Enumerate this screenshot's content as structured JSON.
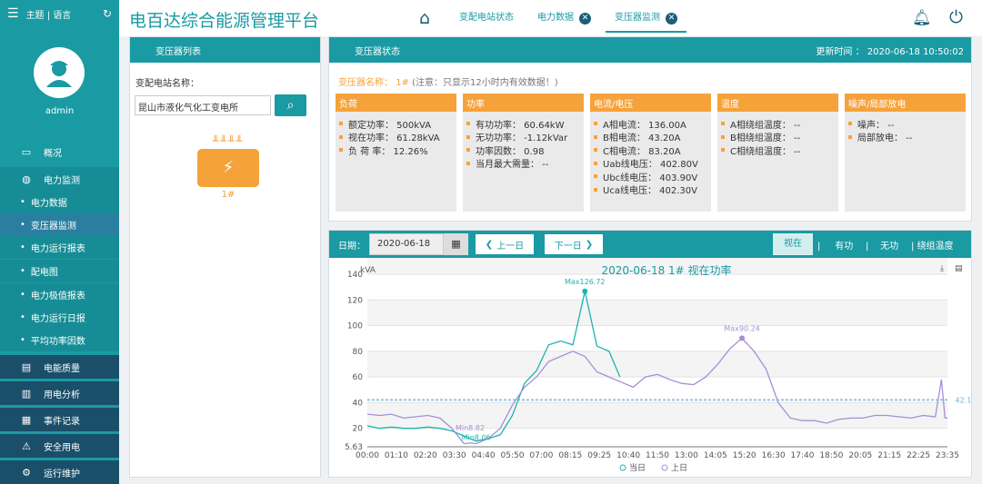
{
  "sidebar": {
    "top_label": "主题 | 语言",
    "user": "admin",
    "items": [
      {
        "icon": "monitor-icon",
        "label": "概况"
      },
      {
        "icon": "power-icon",
        "label": "电力监测"
      }
    ],
    "subitems": [
      "电力数据",
      "变压器监测",
      "电力运行报表",
      "配电图",
      "电力极值报表",
      "电力运行日报",
      "平均功率因数"
    ],
    "items2": [
      {
        "icon": "quality-icon",
        "label": "电能质量"
      },
      {
        "icon": "analysis-icon",
        "label": "用电分析"
      },
      {
        "icon": "event-icon",
        "label": "事件记录"
      },
      {
        "icon": "safety-icon",
        "label": "安全用电"
      },
      {
        "icon": "maintenance-icon",
        "label": "运行维护"
      }
    ]
  },
  "header": {
    "title": "电百达综合能源管理平台",
    "tabs": [
      "变配电站状态",
      "电力数据",
      "变压器监测"
    ]
  },
  "left": {
    "title": "变压器列表",
    "station_label": "变配电站名称：",
    "station_value": "昆山市液化气化工变电所",
    "transformer": "1#"
  },
  "status": {
    "title": "变压器状态",
    "update_time": "更新时间 ： 2020-06-18 10:50:02",
    "name_label": "变压器名称：",
    "name": "1#",
    "note": "(注意：只显示12小时内有效数据！)",
    "cards": [
      {
        "title": "负荷",
        "lines": [
          "额定功率： 500kVA",
          "视在功率： 61.28kVA",
          "负 荷 率： 12.26%"
        ]
      },
      {
        "title": "功率",
        "lines": [
          "有功功率： 60.64kW",
          "无功功率： -1.12kVar",
          "功率因数： 0.98",
          "当月最大需量： --"
        ]
      },
      {
        "title": "电流/电压",
        "lines": [
          "A相电流： 136.00A",
          "B相电流： 43.20A",
          "C相电流： 83.20A",
          "Uab线电压： 402.80V",
          "Ubc线电压： 403.90V",
          "Uca线电压： 402.30V"
        ]
      },
      {
        "title": "温度",
        "lines": [
          "A相绕组温度： --",
          "B相绕组温度： --",
          "C相绕组温度： --"
        ]
      },
      {
        "title": "噪声/局部放电",
        "lines": [
          "噪声： --",
          "局部放电： --"
        ]
      }
    ]
  },
  "chartpanel": {
    "date_label": "日期：",
    "date": "2020-06-18",
    "prev": "上一日",
    "next": "下一日",
    "types": [
      "视在",
      "有功",
      "无功",
      "绕组温度"
    ]
  },
  "chart_data": {
    "type": "line",
    "title": "2020-06-18  1#  视在功率",
    "ylabel": "kVA",
    "ylim": [
      5.63,
      140
    ],
    "yticks": [
      "140",
      "120",
      "100",
      "80",
      "60",
      "40",
      "20",
      "5.63"
    ],
    "xticks": [
      "00:00",
      "01:10",
      "02:20",
      "03:30",
      "04:40",
      "05:50",
      "07:00",
      "08:15",
      "09:25",
      "10:40",
      "11:50",
      "13:00",
      "14:05",
      "15:20",
      "16:30",
      "17:40",
      "18:50",
      "20:05",
      "21:15",
      "22:25",
      "23:35"
    ],
    "series": [
      {
        "name": "当日",
        "color": "#1ab5b0",
        "points": [
          [
            0,
            22
          ],
          [
            1,
            20
          ],
          [
            2,
            21
          ],
          [
            3,
            20
          ],
          [
            4,
            20
          ],
          [
            5,
            21
          ],
          [
            6,
            20
          ],
          [
            7,
            18
          ],
          [
            8,
            14
          ],
          [
            9,
            10
          ],
          [
            10,
            12
          ],
          [
            11,
            15
          ],
          [
            12,
            30
          ],
          [
            13,
            55
          ],
          [
            14,
            65
          ],
          [
            15,
            85
          ],
          [
            16,
            88
          ],
          [
            17,
            85
          ],
          [
            18,
            126.72
          ],
          [
            19,
            84
          ],
          [
            20,
            80
          ],
          [
            20.9,
            60
          ]
        ]
      },
      {
        "name": "上日",
        "color": "#a58fd6",
        "points": [
          [
            0,
            31
          ],
          [
            1,
            30
          ],
          [
            2,
            31
          ],
          [
            3,
            28
          ],
          [
            4,
            29
          ],
          [
            5,
            30
          ],
          [
            6,
            28
          ],
          [
            7,
            20
          ],
          [
            8,
            8
          ],
          [
            8.5,
            8.5
          ],
          [
            9,
            8
          ],
          [
            10,
            12
          ],
          [
            11,
            20
          ],
          [
            12,
            38
          ],
          [
            13,
            52
          ],
          [
            14,
            60
          ],
          [
            15,
            72
          ],
          [
            16,
            76
          ],
          [
            17,
            80
          ],
          [
            18,
            76
          ],
          [
            19,
            64
          ],
          [
            20,
            60
          ],
          [
            21,
            56
          ],
          [
            22,
            52
          ],
          [
            23,
            60
          ],
          [
            24,
            62
          ],
          [
            25,
            58
          ],
          [
            26,
            55
          ],
          [
            27,
            54
          ],
          [
            28,
            60
          ],
          [
            29,
            70
          ],
          [
            30,
            82
          ],
          [
            31,
            90.24
          ],
          [
            32,
            80
          ],
          [
            33,
            66
          ],
          [
            34,
            40
          ],
          [
            35,
            28
          ],
          [
            36,
            26
          ],
          [
            37,
            26
          ],
          [
            38,
            24
          ],
          [
            39,
            27
          ],
          [
            40,
            28
          ],
          [
            41,
            28
          ],
          [
            42,
            30
          ],
          [
            43,
            30
          ],
          [
            44,
            29
          ],
          [
            45,
            28
          ],
          [
            46,
            30
          ],
          [
            47,
            29
          ],
          [
            47.5,
            58
          ],
          [
            47.8,
            28
          ],
          [
            48,
            28
          ]
        ]
      }
    ],
    "annotations": [
      "Max126.72",
      "Max90.24",
      "Min8.82",
      "Min8.06",
      "42.18"
    ],
    "avg_value": 42.18,
    "legend": [
      "当日",
      "上日"
    ]
  }
}
